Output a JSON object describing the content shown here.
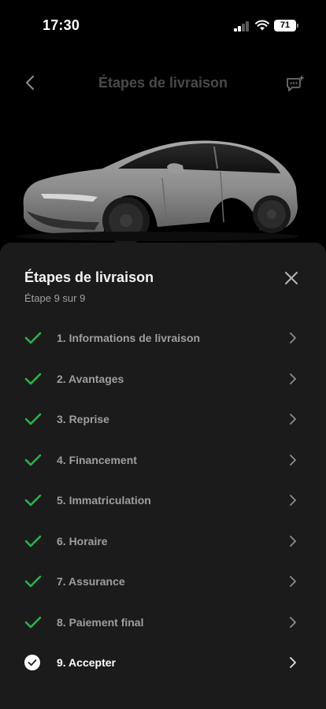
{
  "status_bar": {
    "time": "17:30",
    "battery": "71"
  },
  "header": {
    "title": "Étapes de livraison"
  },
  "sheet": {
    "title": "Étapes de livraison",
    "subtitle": "Étape 9 sur 9",
    "steps": [
      {
        "label": "1. Informations de livraison"
      },
      {
        "label": "2. Avantages"
      },
      {
        "label": "3. Reprise"
      },
      {
        "label": "4. Financement"
      },
      {
        "label": "5. Immatriculation"
      },
      {
        "label": "6. Horaire"
      },
      {
        "label": "7. Assurance"
      },
      {
        "label": "8. Paiement final"
      },
      {
        "label": "9. Accepter"
      }
    ]
  },
  "colors": {
    "check_green": "#2bb24c",
    "sheet_bg": "#1b1b1c",
    "label_dim": "#9e9e9e"
  }
}
